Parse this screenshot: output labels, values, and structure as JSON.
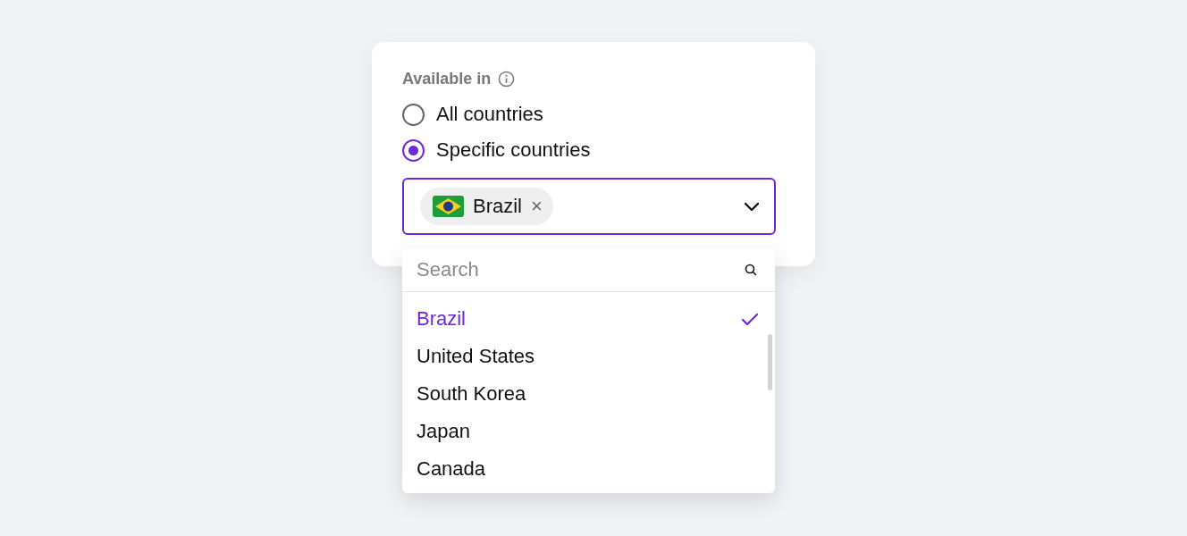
{
  "field": {
    "label": "Available in"
  },
  "radios": [
    {
      "label": "All countries",
      "selected": false
    },
    {
      "label": "Specific countries",
      "selected": true
    }
  ],
  "select": {
    "chips": [
      {
        "label": "Brazil",
        "remove": "×"
      }
    ],
    "expanded": true
  },
  "dropdown": {
    "search": {
      "placeholder": "Search"
    },
    "options": [
      {
        "label": "Brazil",
        "selected": true
      },
      {
        "label": "United States",
        "selected": false
      },
      {
        "label": "South Korea",
        "selected": false
      },
      {
        "label": "Japan",
        "selected": false
      },
      {
        "label": "Canada",
        "selected": false
      }
    ]
  }
}
